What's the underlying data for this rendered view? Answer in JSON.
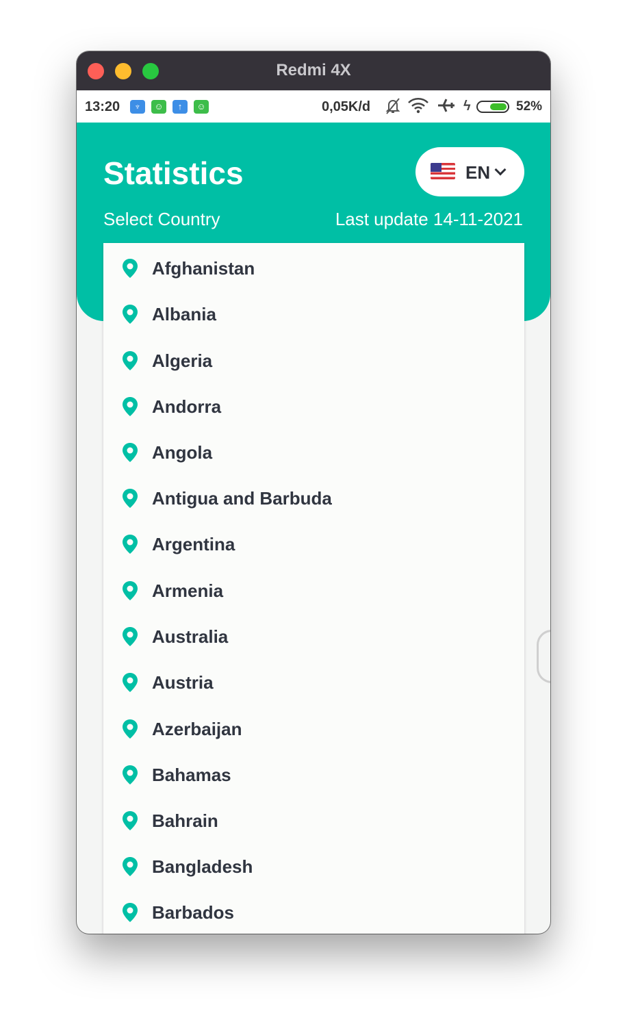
{
  "window": {
    "title": "Redmi 4X"
  },
  "status_bar": {
    "time": "13:20",
    "notification_icons": [
      "shield-icon",
      "android-icon",
      "upload-icon",
      "android-icon"
    ],
    "network_speed": "0,05K/d",
    "battery_percent": "52%",
    "battery_level": 0.52
  },
  "header": {
    "title": "Statistics",
    "select_label": "Select Country",
    "last_update": "Last update 14-11-2021",
    "language": {
      "code": "EN",
      "flag": "us-flag-icon"
    }
  },
  "colors": {
    "accent": "#00bfa5",
    "text": "#303540"
  },
  "countries": [
    "Afghanistan",
    "Albania",
    "Algeria",
    "Andorra",
    "Angola",
    "Antigua and Barbuda",
    "Argentina",
    "Armenia",
    "Australia",
    "Austria",
    "Azerbaijan",
    "Bahamas",
    "Bahrain",
    "Bangladesh",
    "Barbados"
  ]
}
